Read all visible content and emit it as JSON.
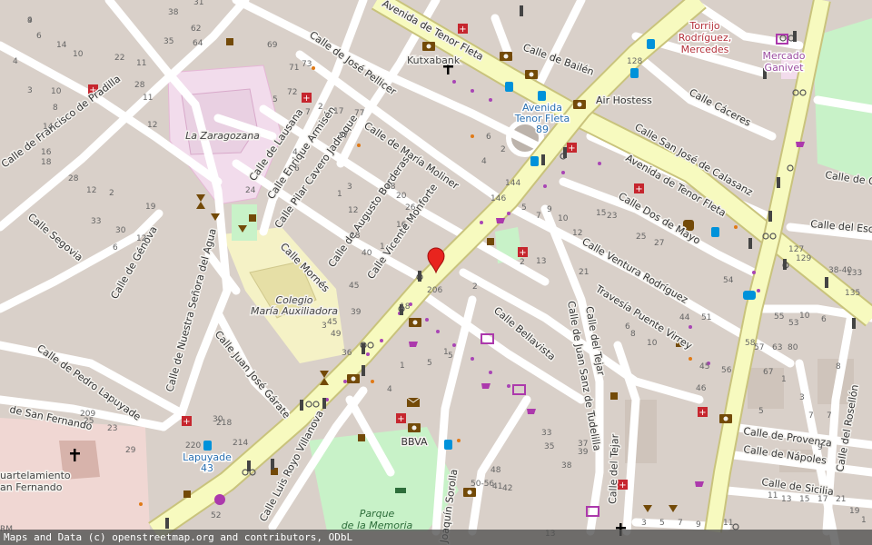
{
  "colors": {
    "background": "#f2efe9",
    "block": "#d9d0c9",
    "street": "#ffffff",
    "primary_road": "#f7fabf",
    "primary_casing": "#c9c37c",
    "school": "#ffffe5",
    "park": "#c8f2c8",
    "barracks": "#f0d7d3",
    "market": "#f2dcec",
    "pin": "#e8241e"
  },
  "street_labels": [
    "Calle de José Pellicer",
    "Avenida de Tenor Fleta",
    "Calle de Bailén",
    "Calle Cáceres",
    "Calle San José de Calasanz",
    "Avenida de Tenor Fleta",
    "Calle de Francisco de Pradilla",
    "Calle de Lausana",
    "Calle Enrique Armisén",
    "Calle Pilar Cavero Jadraque",
    "Calle de María Moliner",
    "Calle de Augusto Borderas",
    "Calle Vicente Monforte",
    "Calle Dos de Mayo",
    "Calle del Escu",
    "Calle Segovia",
    "Calle de Génova",
    "Calle Mornés",
    "Calle Ventura Rodríguez",
    "Travesía Puente Virrey",
    "Calle de Nuestra Señora del Agua",
    "Calle Juan José Gárate",
    "Calle Bellavista",
    "Calle de Juan Sanz de Tudelilla",
    "Calle del Tejar",
    "Calle de Pedro Lapuyade",
    "de San Fernando",
    "Calle Luis Royo Villanova",
    "Calle del Tejar",
    "Calle de Provenza",
    "Calle de Nápoles",
    "Calle de Sicilia",
    "Calle del Rosellón",
    "Joaquín Sorolla",
    "Calle de C"
  ],
  "place_labels": {
    "kutxabank": "Kutxabank",
    "torrijo_1": "Torrijo",
    "torrijo_2": "Rodríguez,",
    "torrijo_3": "Mercedes",
    "mercado_1": "Mercado",
    "mercado_2": "Ganivet",
    "air_hostess": "Air Hostess",
    "bus_stop_1": "Avenida",
    "bus_stop_2": "Tenor Fleta",
    "bus_stop_3": "89",
    "zaragozana": "La Zaragozana",
    "colegio_1": "Colegio",
    "colegio_2": "María Auxiliadora",
    "bbva": "BBVA",
    "lapuyade_1": "Lapuyade",
    "lapuyade_2": "43",
    "cuartel_1": "uartelamiento",
    "cuartel_2": "an Fernando",
    "parque_1": "Parque",
    "parque_2": "de la Memoria",
    "edge_rm": "RM"
  },
  "house_numbers": [
    "4",
    "6",
    "14",
    "10",
    "35",
    "38",
    "31",
    "62",
    "64",
    "69",
    "71",
    "73",
    "4",
    "3",
    "10",
    "8",
    "22",
    "11",
    "28",
    "11",
    "12",
    "14",
    "16",
    "18",
    "2",
    "19",
    "6",
    "12",
    "28",
    "12",
    "30",
    "33",
    "77",
    "72",
    "5",
    "7",
    "2",
    "17",
    "17",
    "18",
    "20",
    "12",
    "1",
    "16",
    "26",
    "24",
    "4",
    "6",
    "1",
    "3",
    "146",
    "128",
    "144",
    "127",
    "129",
    "135",
    "133",
    "2",
    "4",
    "6",
    "2",
    "5",
    "7",
    "9",
    "10",
    "12",
    "13",
    "21",
    "15",
    "23",
    "25",
    "27",
    "44",
    "51",
    "54",
    "53",
    "6",
    "8",
    "10",
    "40",
    "45",
    "49",
    "39",
    "45",
    "28",
    "36",
    "206",
    "2",
    "1",
    "5",
    "18",
    "1",
    "4",
    "5",
    "3",
    "30",
    "218",
    "214",
    "220",
    "52",
    "209",
    "25",
    "23",
    "29",
    "33",
    "35",
    "37",
    "39",
    "38",
    "41",
    "42",
    "50-56",
    "48",
    "45",
    "46",
    "55",
    "56",
    "58",
    "80",
    "63",
    "57",
    "67",
    "1",
    "3",
    "5",
    "7",
    "9",
    "11",
    "13",
    "15",
    "17",
    "21",
    "19",
    "1",
    "3",
    "5",
    "7",
    "9",
    "11",
    "13",
    "38-40",
    "6",
    "8",
    "10",
    "7",
    "9"
  ],
  "icons": [
    "pharmacy-icon",
    "bank-icon",
    "church-icon",
    "bus-stop-icon",
    "bicycle-icon",
    "shop-icon",
    "cafe-icon",
    "playground-icon",
    "parking-icon",
    "marketplace-icon",
    "post-office-icon",
    "location-pin-icon"
  ],
  "attribution": "Maps and Data (c) openstreetmap.org and contributors, ODbL"
}
